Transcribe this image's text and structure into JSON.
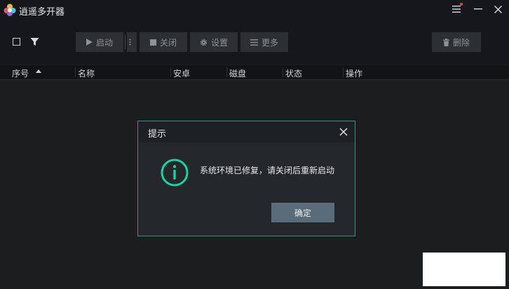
{
  "app": {
    "title": "逍遥多开器",
    "accent_color": "#3a8f7d"
  },
  "window_controls": {
    "menu_icon": "hamburger-icon",
    "minimize_icon": "minimize-icon",
    "close_icon": "close-icon"
  },
  "toolbar": {
    "start_label": "启动",
    "close_label": "关闭",
    "settings_label": "设置",
    "more_label": "更多",
    "delete_label": "删除"
  },
  "table": {
    "columns": [
      "序号",
      "名称",
      "安卓",
      "磁盘",
      "状态",
      "操作"
    ],
    "sorted_column": "序号",
    "sort_direction": "ascending",
    "rows": []
  },
  "dialog": {
    "title": "提示",
    "message": "系统环境已修复，请关闭后重新启动",
    "confirm_label": "确定",
    "icon": "info-icon"
  }
}
